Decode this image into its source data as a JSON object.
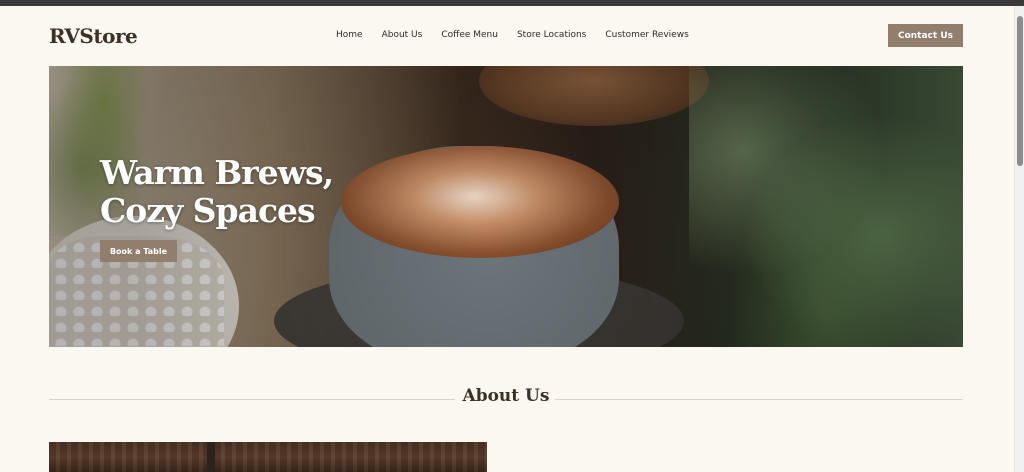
{
  "site": {
    "brand": "RVStore"
  },
  "nav": {
    "items": [
      "Home",
      "About Us",
      "Coffee Menu",
      "Store Locations",
      "Customer Reviews"
    ]
  },
  "header": {
    "contact_label": "Contact Us"
  },
  "hero": {
    "title_line1": "Warm Brews,",
    "title_line2": "Cozy Spaces",
    "cta_label": "Book a Table"
  },
  "about": {
    "title": "About Us"
  },
  "colors": {
    "background": "#fbf8f2",
    "accent": "#927e6c",
    "text": "#3b2f26"
  }
}
